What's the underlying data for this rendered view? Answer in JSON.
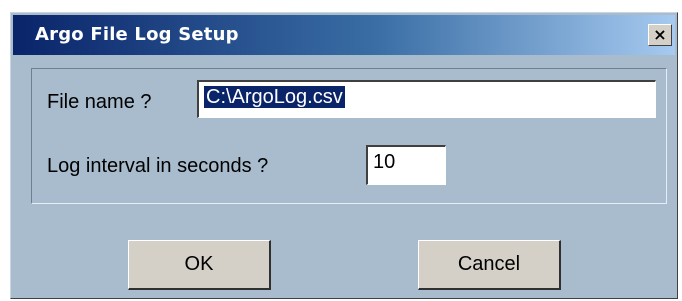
{
  "window": {
    "title": "Argo File Log Setup",
    "close_label": "×"
  },
  "form": {
    "file_name_label": "File name ?",
    "file_name_value": "C:\\ArgoLog.csv",
    "interval_label": "Log interval in seconds ?",
    "interval_value": "10"
  },
  "buttons": {
    "ok_label": "OK",
    "cancel_label": "Cancel"
  },
  "colors": {
    "dialog_bg": "#a8bccd",
    "titlebar_start": "#0a246a",
    "titlebar_end": "#a6caf0",
    "selection_bg": "#0a246a",
    "button_face": "#d4d0c8"
  }
}
